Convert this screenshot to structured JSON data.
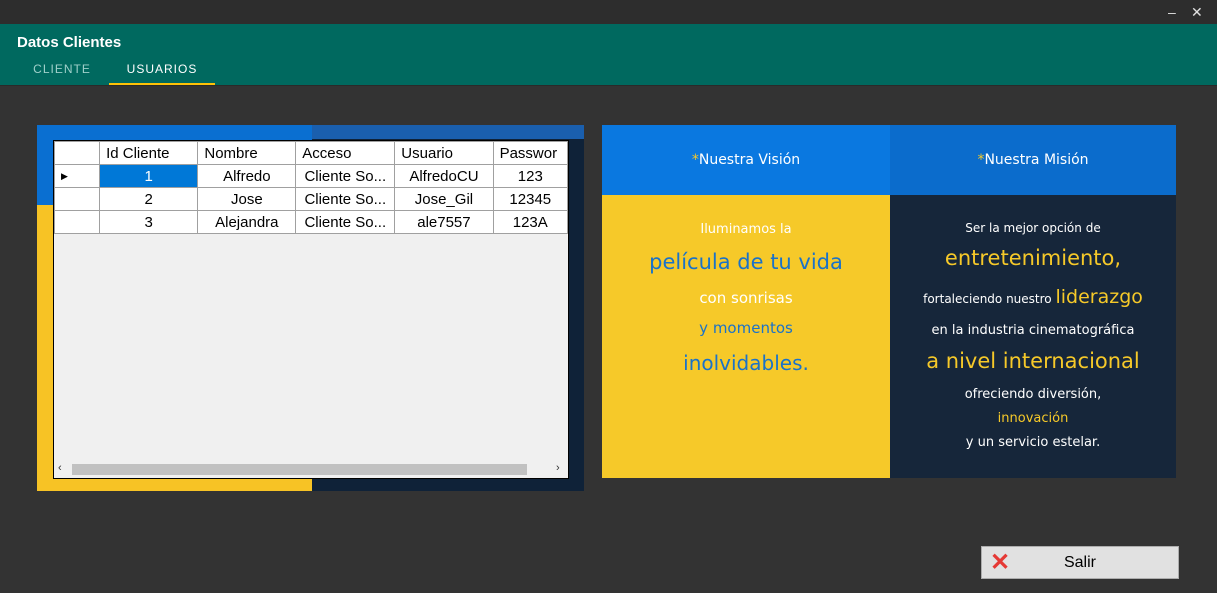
{
  "window": {
    "minimize": "–",
    "close": "✕"
  },
  "app_title": "Datos Clientes",
  "tabs": [
    {
      "label": "CLIENTE",
      "active": false
    },
    {
      "label": "USUARIOS",
      "active": true
    }
  ],
  "grid": {
    "columns": [
      "Id Cliente",
      "Nombre",
      "Acceso",
      "Usuario",
      "Passwor"
    ],
    "rows": [
      {
        "id": "1",
        "nombre": "Alfredo",
        "acceso": "Cliente So...",
        "usuario": "AlfredoCU",
        "password": "123"
      },
      {
        "id": "2",
        "nombre": "Jose",
        "acceso": "Cliente So...",
        "usuario": "Jose_Gil",
        "password": "12345"
      },
      {
        "id": "3",
        "nombre": "Alejandra",
        "acceso": "Cliente So...",
        "usuario": "ale7557",
        "password": "123A"
      }
    ],
    "current_row_marker": "▶",
    "scroll_left": "‹",
    "scroll_right": "›"
  },
  "banner": {
    "vision": {
      "heading": "Nuestra Visión",
      "star": "*",
      "lines": [
        "Iluminamos la",
        "película de tu vida",
        "con sonrisas",
        "y momentos",
        "inolvidables."
      ]
    },
    "mission": {
      "heading": "Nuestra Misión",
      "star": "*",
      "line1": "Ser la mejor opción de",
      "line2": "entretenimiento,",
      "line3a": "fortaleciendo nuestro ",
      "line3b": "liderazgo",
      "line4": "en la industria cinematográfica",
      "line5": "a nivel internacional",
      "line6": "ofreciendo diversión,",
      "line7": "innovación",
      "line8": "y un servicio estelar."
    }
  },
  "salir": {
    "label": "Salir",
    "icon": "close-x-icon"
  },
  "colors": {
    "header": "#00695f",
    "tab_indicator": "#ffc107",
    "selection": "#0078d7"
  }
}
